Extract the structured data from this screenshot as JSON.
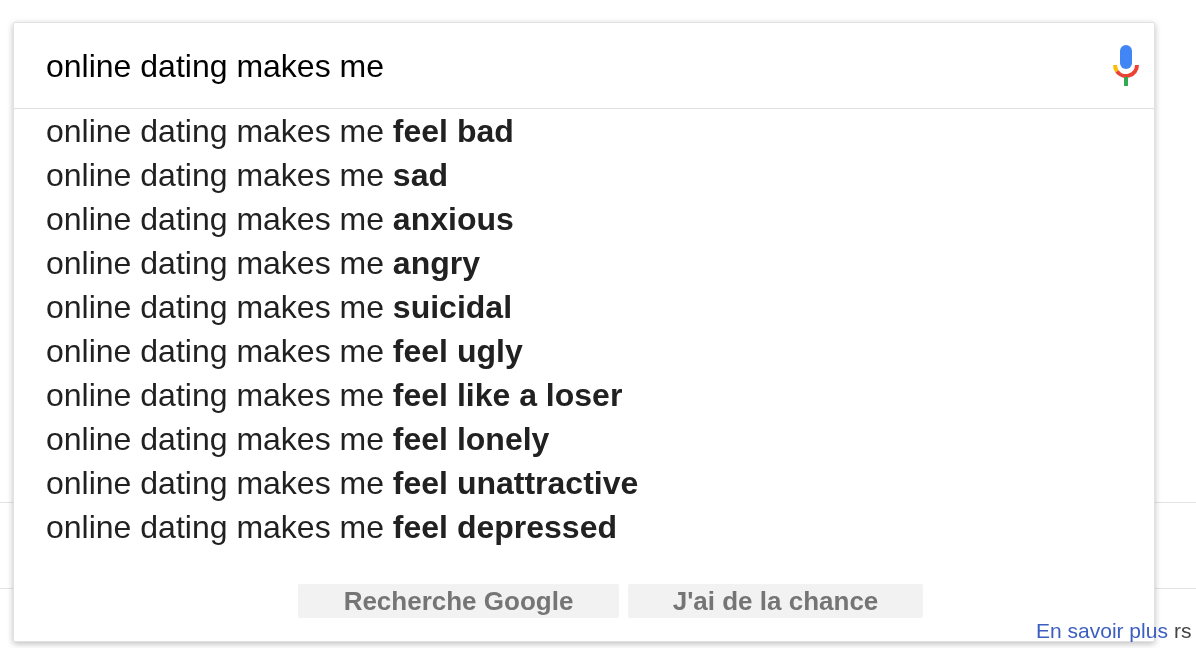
{
  "search": {
    "value": "online dating makes me"
  },
  "suggestions": [
    {
      "text": "online dating makes me **feel bad**"
    },
    {
      "text": "online dating makes me **sad**"
    },
    {
      "text": "online dating makes me **anxious**"
    },
    {
      "text": "online dating makes me **angry**"
    },
    {
      "text": "online dating makes me **suicidal**"
    },
    {
      "text": "online dating makes me **feel ugly**"
    },
    {
      "text": "online dating makes me **feel like a loser**"
    },
    {
      "text": "online dating makes me **feel lonely**"
    },
    {
      "text": "online dating makes me **feel unattractive**"
    },
    {
      "text": "online dating makes me **feel depressed**"
    }
  ],
  "buttons": [
    "Recherche Google",
    "J'ai de la chance"
  ],
  "link": "En savoir plus",
  "background_text": "rs"
}
